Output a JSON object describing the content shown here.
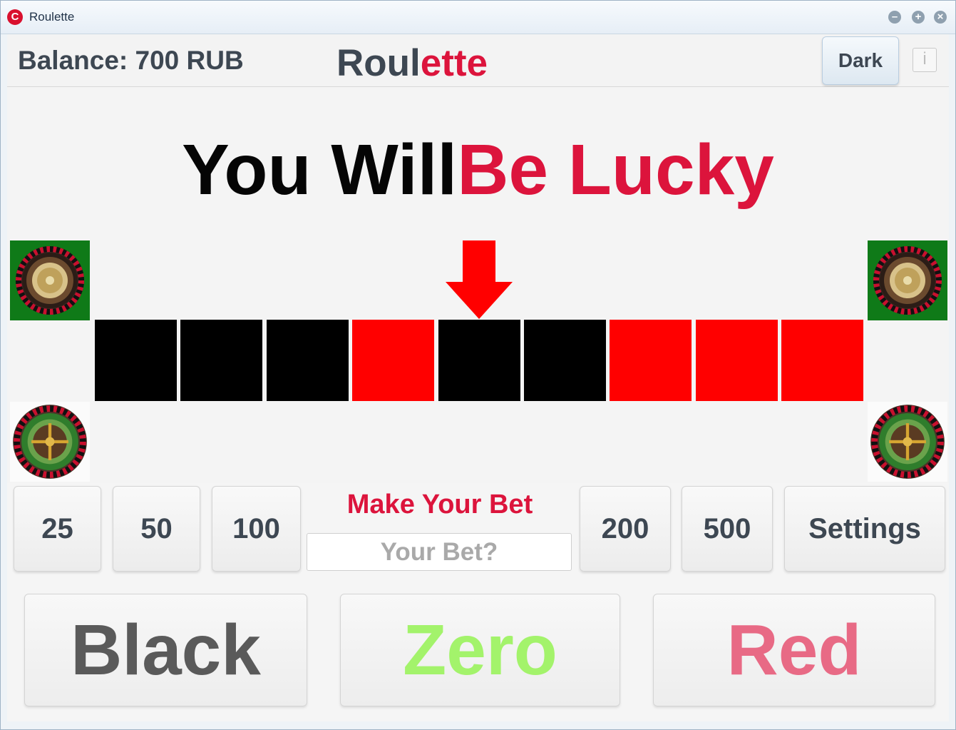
{
  "window": {
    "title": "Roulette",
    "app_icon_letter": "C",
    "controls": {
      "minimize": "–",
      "maximize": "+",
      "close": "×"
    }
  },
  "header": {
    "balance": "Balance: 700 RUB",
    "logo_part1": "Roul",
    "logo_part2": "ette",
    "theme_button": "Dark",
    "info_button": "i"
  },
  "slogan": {
    "part1": "You Will",
    "part2": "Be Lucky"
  },
  "strip": {
    "cells": [
      "black",
      "black",
      "black",
      "red",
      "black",
      "black",
      "red",
      "red",
      "red"
    ]
  },
  "colors": {
    "accent": "#dc143c",
    "black_cell": "#000000",
    "red_cell": "#ff0000",
    "pointer": "#ff0000",
    "zero": "#a3f36b",
    "red_text": "#e86a85",
    "black_text": "#5a5a5a",
    "wheel_green": "#0f7a18"
  },
  "bet": {
    "title": "Make Your Bet",
    "placeholder": "Your Bet?",
    "value": "",
    "chips_left": [
      "25",
      "50",
      "100"
    ],
    "chips_right": [
      "200",
      "500"
    ],
    "settings": "Settings"
  },
  "choices": {
    "black": "Black",
    "zero": "Zero",
    "red": "Red"
  },
  "icons": [
    "app-logo-icon",
    "roulette-wheel-icon",
    "down-arrow-icon",
    "info-icon"
  ]
}
